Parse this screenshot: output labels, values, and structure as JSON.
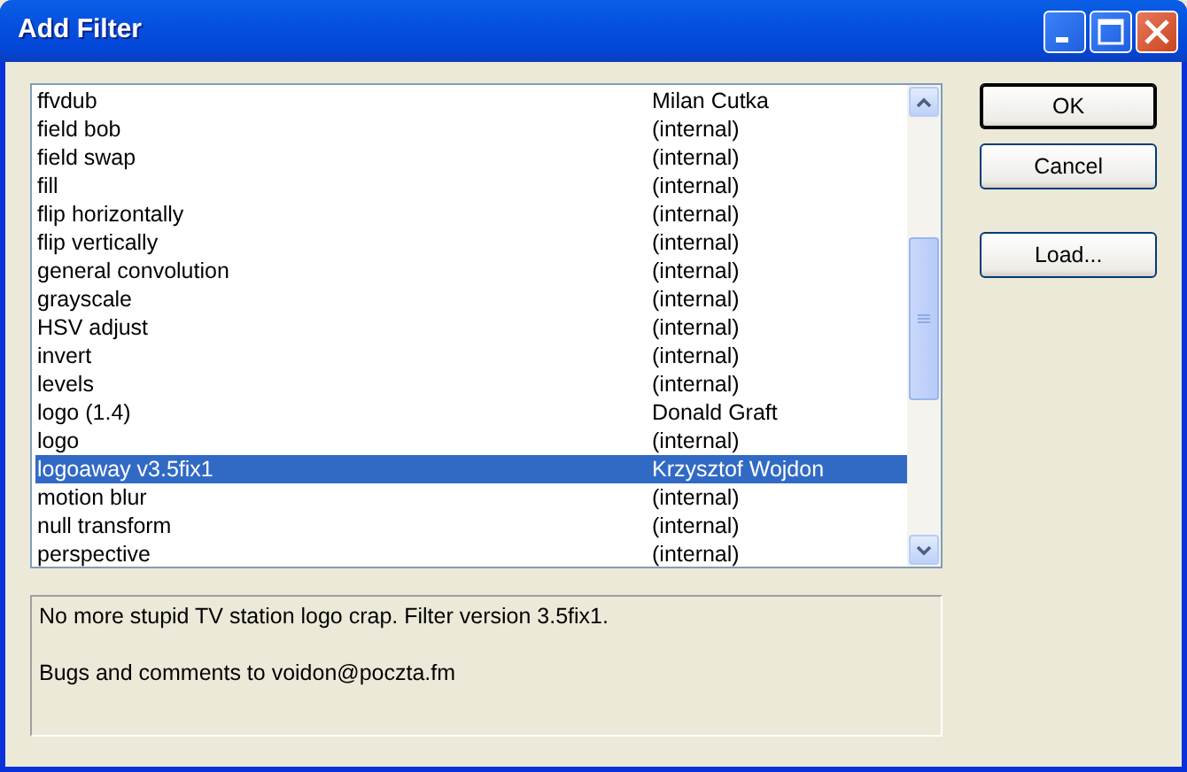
{
  "window": {
    "title": "Add Filter"
  },
  "filters": [
    {
      "name": "ffvdub",
      "author": "Milan Cutka",
      "selected": false
    },
    {
      "name": "field bob",
      "author": "(internal)",
      "selected": false
    },
    {
      "name": "field swap",
      "author": "(internal)",
      "selected": false
    },
    {
      "name": "fill",
      "author": "(internal)",
      "selected": false
    },
    {
      "name": "flip horizontally",
      "author": "(internal)",
      "selected": false
    },
    {
      "name": "flip vertically",
      "author": "(internal)",
      "selected": false
    },
    {
      "name": "general convolution",
      "author": "(internal)",
      "selected": false
    },
    {
      "name": "grayscale",
      "author": "(internal)",
      "selected": false
    },
    {
      "name": "HSV adjust",
      "author": "(internal)",
      "selected": false
    },
    {
      "name": "invert",
      "author": "(internal)",
      "selected": false
    },
    {
      "name": "levels",
      "author": "(internal)",
      "selected": false
    },
    {
      "name": "logo (1.4)",
      "author": "Donald Graft",
      "selected": false
    },
    {
      "name": "logo",
      "author": "(internal)",
      "selected": false
    },
    {
      "name": "logoaway v3.5fix1",
      "author": "Krzysztof Wojdon",
      "selected": true
    },
    {
      "name": "motion blur",
      "author": "(internal)",
      "selected": false
    },
    {
      "name": "null transform",
      "author": "(internal)",
      "selected": false
    },
    {
      "name": "perspective",
      "author": "(internal)",
      "selected": false
    }
  ],
  "description": [
    "No more stupid TV station logo crap. Filter version 3.5fix1.",
    "Bugs and comments to voidon@poczta.fm"
  ],
  "buttons": [
    {
      "label": "OK",
      "default": true
    },
    {
      "label": "Cancel",
      "default": false
    },
    {
      "label": "Load...",
      "default": false
    }
  ]
}
